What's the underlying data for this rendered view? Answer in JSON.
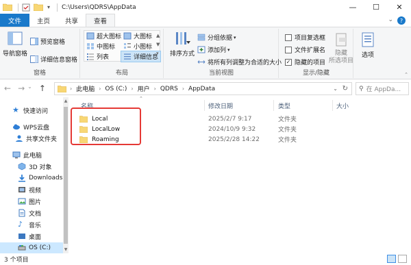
{
  "window": {
    "path_title": "C:\\Users\\QDRS\\AppData"
  },
  "tabs": [
    {
      "label": "文件"
    },
    {
      "label": "主页"
    },
    {
      "label": "共享"
    },
    {
      "label": "查看"
    }
  ],
  "ribbon": {
    "panes": {
      "label": "窗格",
      "nav_pane": "导航窗格",
      "preview_pane": "预览窗格",
      "details_pane": "详细信息窗格"
    },
    "layout": {
      "label": "布局",
      "xl_icons": "超大图标",
      "large_icons": "大图标",
      "medium_icons": "中图标",
      "small_icons": "小图标",
      "list": "列表",
      "details": "详细信息"
    },
    "current_view": {
      "label": "当前视图",
      "sort_by": "排序方式",
      "group_by": "分组依据",
      "add_column": "添加列",
      "size_all_columns": "将所有列调整为合适的大小"
    },
    "show_hide": {
      "label": "显示/隐藏",
      "item_checkboxes": "项目复选框",
      "file_extensions": "文件扩展名",
      "hidden_items": "隐藏的项目",
      "hide_selected": "隐藏\n所选项目",
      "hide_l1": "隐藏",
      "hide_l2": "所选项目"
    },
    "options": {
      "label": "选项"
    }
  },
  "address": {
    "crumbs": [
      "此电脑",
      "OS (C:)",
      "用户",
      "QDRS",
      "AppData"
    ],
    "search_placeholder": "在 AppDa..."
  },
  "nav": {
    "items": [
      {
        "label": "快速访问"
      },
      {
        "label": "WPS云盘"
      },
      {
        "label": "共享文件夹"
      },
      {
        "label": "此电脑"
      },
      {
        "label": "3D 对象"
      },
      {
        "label": "Downloads"
      },
      {
        "label": "视频"
      },
      {
        "label": "图片"
      },
      {
        "label": "文档"
      },
      {
        "label": "音乐"
      },
      {
        "label": "桌面"
      },
      {
        "label": "OS (C:)"
      }
    ]
  },
  "columns": {
    "name": "名称",
    "modified": "修改日期",
    "type": "类型",
    "size": "大小"
  },
  "files": [
    {
      "name": "Local",
      "modified": "2025/2/7 9:17",
      "type": "文件夹"
    },
    {
      "name": "LocalLow",
      "modified": "2024/10/9 9:32",
      "type": "文件夹"
    },
    {
      "name": "Roaming",
      "modified": "2025/2/28 14:22",
      "type": "文件夹"
    }
  ],
  "status": {
    "item_count": "3 个项目"
  },
  "colors": {
    "accent": "#1979ca",
    "folder": "#f8d775",
    "highlight_box": "#e53935"
  }
}
